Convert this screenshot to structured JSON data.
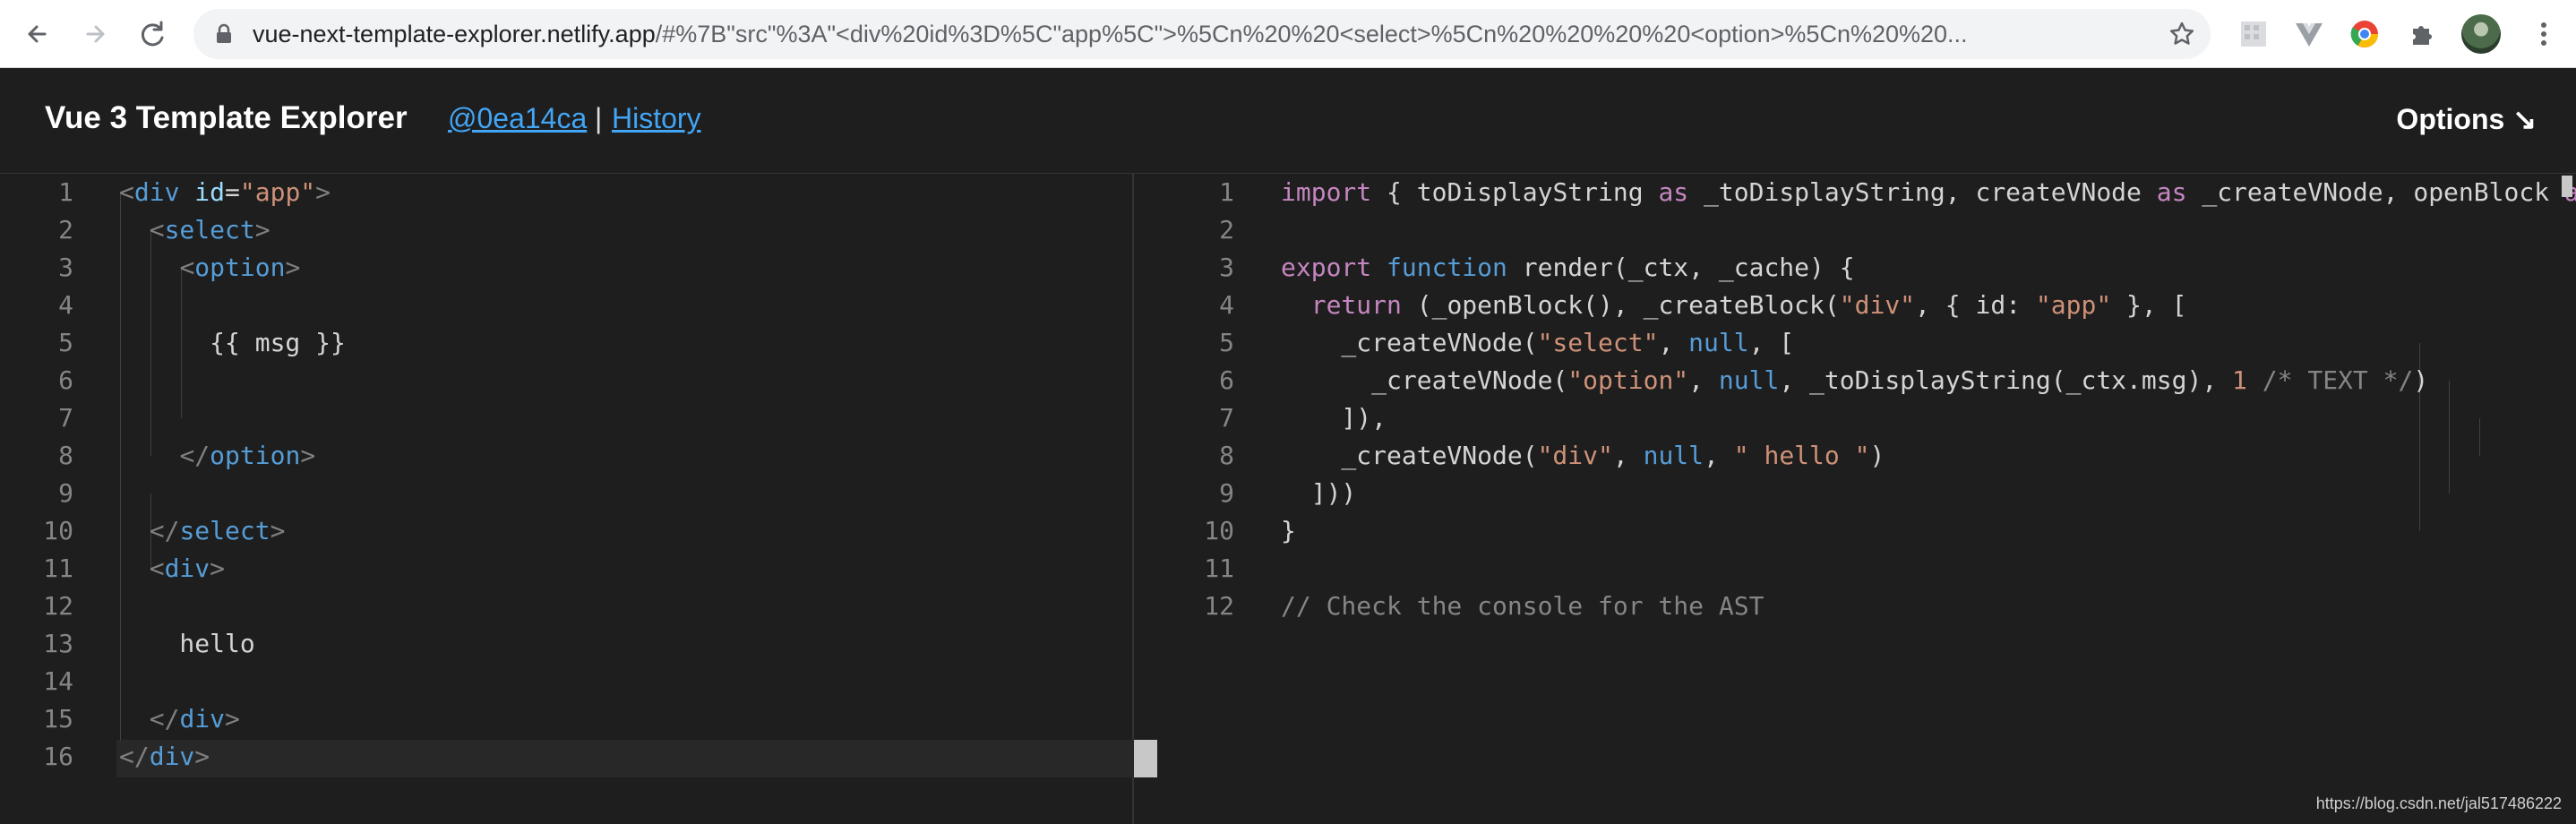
{
  "browser": {
    "url_host": "vue-next-template-explorer.netlify.app",
    "url_rest": "/#%7B\"src\"%3A\"<div%20id%3D%5C\"app%5C\">%5Cn%20%20<select>%5Cn%20%20%20%20<option>%5Cn%20%20..."
  },
  "header": {
    "title": "Vue 3 Template Explorer",
    "commit": "@0ea14ca",
    "separator": "|",
    "history": "History",
    "options": "Options ↘"
  },
  "template_editor": {
    "line_numbers": [
      "1",
      "2",
      "3",
      "4",
      "5",
      "6",
      "7",
      "8",
      "9",
      "10",
      "11",
      "12",
      "13",
      "14",
      "15",
      "16"
    ]
  },
  "output_editor": {
    "line_numbers": [
      "1",
      "2",
      "3",
      "4",
      "5",
      "6",
      "7",
      "8",
      "9",
      "10",
      "11",
      "12"
    ]
  },
  "watermark": "https://blog.csdn.net/jal517486222"
}
